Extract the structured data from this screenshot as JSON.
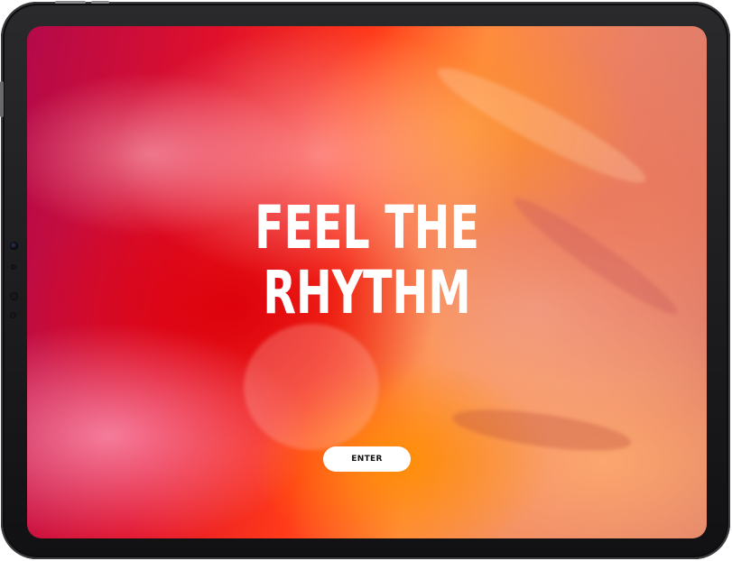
{
  "hero": {
    "headline_line1": "FEEL THE",
    "headline_line2": "RHYTHM",
    "enter_label": "ENTER"
  },
  "colors": {
    "background_gradient": [
      "#b40a4a",
      "#e0102a",
      "#ff3a1a",
      "#ff8a40",
      "#e98068"
    ],
    "headline_text": "#ffffff",
    "button_bg": "#ffffff",
    "button_text": "#111111",
    "device_frame": "#1a1a1c"
  }
}
